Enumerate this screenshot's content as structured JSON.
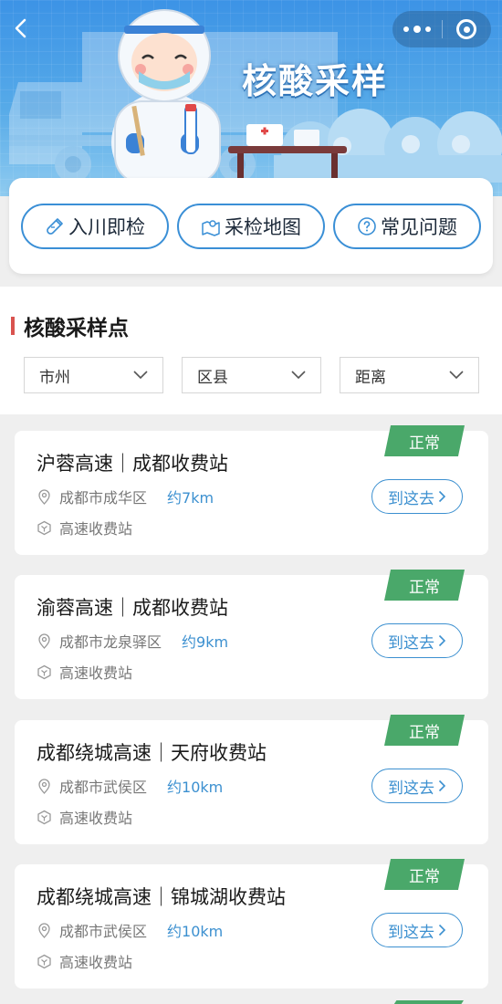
{
  "banner": {
    "title": "核酸采样",
    "back_icon": "chevron-left-icon",
    "more_icon": "more-dots-icon",
    "close_icon": "target-close-icon",
    "colors": {
      "sky_top": "#3c93e6",
      "sky_bottom": "#8fcbf0"
    }
  },
  "actions": [
    {
      "label": "入川即检",
      "icon": "test-tube-icon"
    },
    {
      "label": "采检地图",
      "icon": "map-location-icon"
    },
    {
      "label": "常见问题",
      "icon": "question-circle-icon"
    }
  ],
  "section": {
    "title": "核酸采样点",
    "accent": "#d9534f",
    "filters": [
      {
        "label": "市州"
      },
      {
        "label": "区县"
      },
      {
        "label": "距离"
      }
    ]
  },
  "sites": [
    {
      "name": "沪蓉高速｜成都收费站",
      "district": "成都市成华区",
      "distance": "约7km",
      "type": "高速收费站",
      "status": "正常",
      "action": "到这去"
    },
    {
      "name": "渝蓉高速｜成都收费站",
      "district": "成都市龙泉驿区",
      "distance": "约9km",
      "type": "高速收费站",
      "status": "正常",
      "action": "到这去"
    },
    {
      "name": "成都绕城高速｜天府收费站",
      "district": "成都市武侯区",
      "distance": "约10km",
      "type": "高速收费站",
      "status": "正常",
      "action": "到这去"
    },
    {
      "name": "成都绕城高速｜锦城湖收费站",
      "district": "成都市武侯区",
      "distance": "约10km",
      "type": "高速收费站",
      "status": "正常",
      "action": "到这去"
    }
  ],
  "colors": {
    "status_green": "#4aa86a",
    "link_blue": "#3c90d0",
    "action_border": "#3a8fd6"
  }
}
